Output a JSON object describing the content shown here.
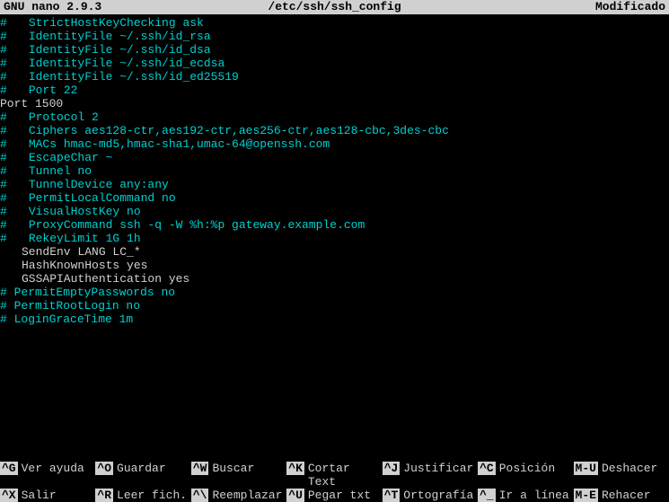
{
  "titlebar": {
    "app": "GNU nano 2.9.3",
    "file": "/etc/ssh/ssh_config",
    "status": "Modificado"
  },
  "lines": [
    {
      "h": true,
      "indent": true,
      "text": "StrictHostKeyChecking ask",
      "cyan": true
    },
    {
      "h": true,
      "indent": true,
      "text": "IdentityFile ~/.ssh/id_rsa",
      "cyan": true
    },
    {
      "h": true,
      "indent": true,
      "text": "IdentityFile ~/.ssh/id_dsa",
      "cyan": true
    },
    {
      "h": true,
      "indent": true,
      "text": "IdentityFile ~/.ssh/id_ecdsa",
      "cyan": true
    },
    {
      "h": true,
      "indent": true,
      "text": "IdentityFile ~/.ssh/id_ed25519",
      "cyan": true
    },
    {
      "h": true,
      "indent": true,
      "text": "Port 22",
      "cyan": true
    },
    {
      "h": false,
      "indent": false,
      "text": "Port 1500",
      "cyan": false
    },
    {
      "h": true,
      "indent": true,
      "text": "Protocol 2",
      "cyan": true
    },
    {
      "h": true,
      "indent": true,
      "text": "Ciphers aes128-ctr,aes192-ctr,aes256-ctr,aes128-cbc,3des-cbc",
      "cyan": true
    },
    {
      "h": true,
      "indent": true,
      "text": "MACs hmac-md5,hmac-sha1,umac-64@openssh.com",
      "cyan": true
    },
    {
      "h": true,
      "indent": true,
      "text": "EscapeChar ~",
      "cyan": true
    },
    {
      "h": true,
      "indent": true,
      "text": "Tunnel no",
      "cyan": true
    },
    {
      "h": true,
      "indent": true,
      "text": "TunnelDevice any:any",
      "cyan": true
    },
    {
      "h": true,
      "indent": true,
      "text": "PermitLocalCommand no",
      "cyan": true
    },
    {
      "h": true,
      "indent": true,
      "text": "VisualHostKey no",
      "cyan": true
    },
    {
      "h": true,
      "indent": true,
      "text": "ProxyCommand ssh -q -W %h:%p gateway.example.com",
      "cyan": true
    },
    {
      "h": true,
      "indent": true,
      "text": "RekeyLimit 1G 1h",
      "cyan": true
    },
    {
      "h": false,
      "indent": true,
      "text": "SendEnv LANG LC_*",
      "cyan": false
    },
    {
      "h": false,
      "indent": true,
      "text": "HashKnownHosts yes",
      "cyan": false
    },
    {
      "h": false,
      "indent": true,
      "text": "GSSAPIAuthentication yes",
      "cyan": false
    },
    {
      "h": true,
      "indent": false,
      "text": " PermitEmptyPasswords no",
      "cyan": true
    },
    {
      "h": true,
      "indent": false,
      "text": " PermitRootLogin no",
      "cyan": true
    },
    {
      "h": true,
      "indent": false,
      "text": " LoginGraceTime 1m",
      "cyan": true
    }
  ],
  "shortcuts": {
    "row1": [
      {
        "key": "^G",
        "desc": "Ver ayuda"
      },
      {
        "key": "^O",
        "desc": "Guardar"
      },
      {
        "key": "^W",
        "desc": "Buscar"
      },
      {
        "key": "^K",
        "desc": "Cortar Text"
      },
      {
        "key": "^J",
        "desc": "Justificar"
      },
      {
        "key": "^C",
        "desc": "Posición"
      },
      {
        "key": "M-U",
        "desc": "Deshacer"
      }
    ],
    "row2": [
      {
        "key": "^X",
        "desc": "Salir"
      },
      {
        "key": "^R",
        "desc": "Leer fich."
      },
      {
        "key": "^\\",
        "desc": "Reemplazar"
      },
      {
        "key": "^U",
        "desc": "Pegar txt"
      },
      {
        "key": "^T",
        "desc": "Ortografía"
      },
      {
        "key": "^_",
        "desc": "Ir a línea"
      },
      {
        "key": "M-E",
        "desc": "Rehacer"
      }
    ]
  }
}
